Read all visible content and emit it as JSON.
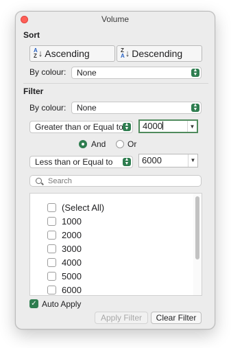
{
  "window": {
    "title": "Volume"
  },
  "sort": {
    "heading": "Sort",
    "ascending": {
      "label": "Ascending",
      "icon_top": "A",
      "icon_bottom": "Z",
      "arrow": "↓"
    },
    "descending": {
      "label": "Descending",
      "icon_top": "Z",
      "icon_bottom": "A",
      "arrow": "↓"
    },
    "by_colour_label": "By colour:",
    "by_colour_value": "None"
  },
  "filter": {
    "heading": "Filter",
    "by_colour_label": "By colour:",
    "by_colour_value": "None",
    "condition1": {
      "operator": "Greater than or Equal to",
      "value": "4000"
    },
    "logic": {
      "and_label": "And",
      "or_label": "Or",
      "selected": "And"
    },
    "condition2": {
      "operator": "Less than or Equal to",
      "value": "6000"
    },
    "search": {
      "placeholder": "Search"
    },
    "items": [
      {
        "label": "(Select All)",
        "checked": false
      },
      {
        "label": "1000",
        "checked": false
      },
      {
        "label": "2000",
        "checked": false
      },
      {
        "label": "3000",
        "checked": false
      },
      {
        "label": "4000",
        "checked": false
      },
      {
        "label": "5000",
        "checked": false
      },
      {
        "label": "6000",
        "checked": false
      }
    ]
  },
  "footer": {
    "auto_apply_label": "Auto Apply",
    "auto_apply_checked": true,
    "apply_filter_label": "Apply Filter",
    "clear_filter_label": "Clear Filter"
  },
  "colors": {
    "accent": "#2e7d4f",
    "close_button": "#fe5f57",
    "sort_icon": "#2a63c4"
  },
  "icons": {
    "close": "close-icon",
    "search": "search-icon",
    "stepper": "chevron-updown-icon",
    "combo_dropdown": "chevron-down-icon",
    "checkmark": "checkmark-icon"
  }
}
